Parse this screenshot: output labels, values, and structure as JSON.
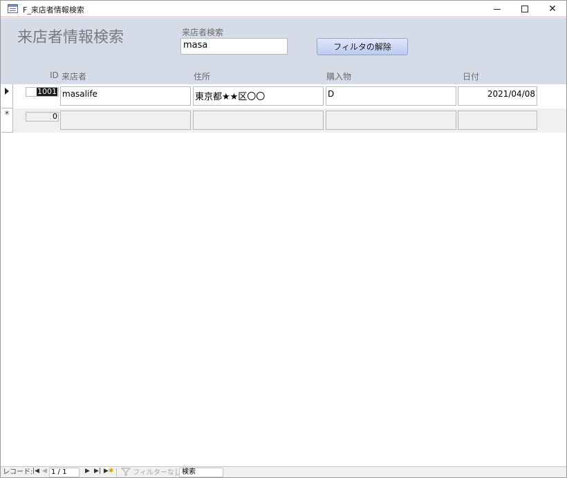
{
  "window": {
    "title": "F_来店者情報検索"
  },
  "header": {
    "form_title": "来店者情報検索",
    "search_label": "来店者検索",
    "search_value": "masa",
    "filter_button": "フィルタの解除"
  },
  "columns": {
    "id": "ID",
    "visitor": "来店者",
    "address": "住所",
    "purchase": "購入物",
    "date": "日付"
  },
  "records": [
    {
      "id": "1001",
      "visitor": "masalife",
      "address": "東京都★★区〇〇",
      "purchase": "D",
      "date": "2021/04/08"
    }
  ],
  "new_record": {
    "id": "0",
    "marker": "*"
  },
  "status_bar": {
    "record_label": "レコード:",
    "record_position": "1 / 1",
    "filter_status": "フィルターなし",
    "search_placeholder": "検索"
  }
}
